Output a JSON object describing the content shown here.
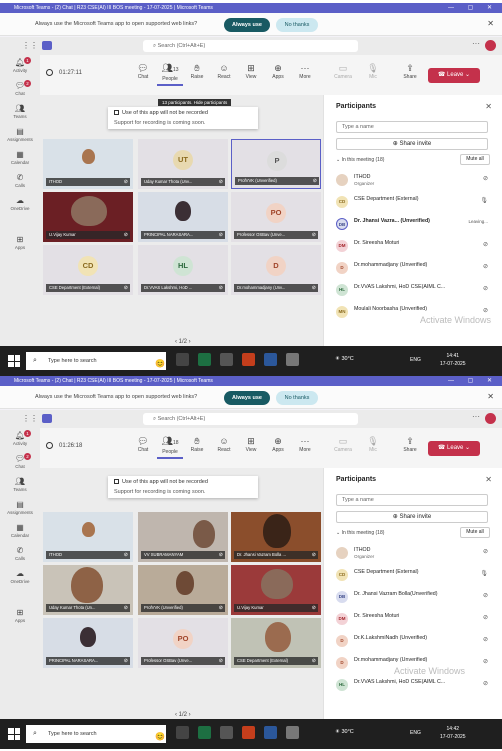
{
  "screens": [
    {
      "title": "Microsoft Teams - (2) Chat | R23 CSE(AI) III BOS meeting - 17-07-2025 | Microsoft Teams",
      "infobar": {
        "message": "Always use the Microsoft Teams app to open supported web links?",
        "always_use": "Always use",
        "no_thanks": "No thanks"
      },
      "search_placeholder": "Search (Ctrl+Alt+E)",
      "rail": [
        "Activity",
        "Chat",
        "Teams",
        "Assignments",
        "Calendar",
        "Calls",
        "OneDrive",
        "Apps"
      ],
      "rail_badges": {
        "Activity": "1",
        "Chat": "2"
      },
      "timer": "01:27:11",
      "people_count": "13",
      "toolbar": [
        "Chat",
        "People",
        "Raise",
        "React",
        "View",
        "Apps",
        "More",
        "Camera",
        "Mic",
        "Share"
      ],
      "leave": "Leave",
      "tooltip": "13 participants. Hide participants",
      "banner": {
        "line1": "Use of this app will not be recorded",
        "line2": "Support for recording is coming soon."
      },
      "tiles": [
        {
          "initials": "",
          "name": "ITHOD"
        },
        {
          "initials": "UT",
          "name": "Uday Kumar Thota (Unv..."
        },
        {
          "initials": "P",
          "name": "ProfVVK (Unverified)"
        },
        {
          "initials": "",
          "name": "U.Vijay Kumar"
        },
        {
          "initials": "",
          "name": "PRINCIPAL NARASARA..."
        },
        {
          "initials": "PO",
          "name": "Professor OSBav (Unve..."
        },
        {
          "initials": "CD",
          "name": "CSE Department (External)"
        },
        {
          "initials": "HL",
          "name": "Dr.VVAS Lakshmi, HoD ..."
        },
        {
          "initials": "D",
          "name": "Dr.mohammadjany (Unv..."
        }
      ],
      "pager": "1/2",
      "panel": {
        "title": "Participants",
        "search_placeholder": "Type a name",
        "share_invite": "Share invite",
        "section": "In this meeting (18)",
        "mute_all": "Mute all",
        "people": [
          {
            "initials": "",
            "name": "ITHOD",
            "role": "Organizer"
          },
          {
            "initials": "CD",
            "name": "CSE Department (External)",
            "role": ""
          },
          {
            "initials": "DB",
            "name": "Dr. Jhansi Vazra... (Unverified)",
            "role": "",
            "extra": "Leaving..."
          },
          {
            "initials": "DM",
            "name": "Dr. Sireesha Moturi",
            "role": ""
          },
          {
            "initials": "D",
            "name": "Dr.mohammadjany (Unverified)",
            "role": ""
          },
          {
            "initials": "HL",
            "name": "Dr.VVAS Lakshmi, HoD CSE(AIML C...",
            "role": ""
          },
          {
            "initials": "MN",
            "name": "Moulali Noorbasha (Unverified)",
            "role": ""
          }
        ]
      },
      "watermark": "Activate Windows",
      "taskbar": {
        "search": "Type here to search",
        "weather": "30°C",
        "lang": "ENG",
        "time": "14:41",
        "date": "17-07-2025"
      }
    },
    {
      "title": "Microsoft Teams - (2) Chat | R23 CSE(AI) III BOS meeting - 17-07-2025 | Microsoft Teams",
      "infobar": {
        "message": "Always use the Microsoft Teams app to open supported web links?",
        "always_use": "Always use",
        "no_thanks": "No thanks"
      },
      "search_placeholder": "Search (Ctrl+Alt+E)",
      "rail": [
        "Activity",
        "Chat",
        "Teams",
        "Assignments",
        "Calendar",
        "Calls",
        "OneDrive",
        "Apps"
      ],
      "rail_badges": {
        "Activity": "1",
        "Chat": "2"
      },
      "timer": "01:26:18",
      "people_count": "18",
      "toolbar": [
        "Chat",
        "People",
        "Raise",
        "React",
        "View",
        "Apps",
        "More",
        "Camera",
        "Mic",
        "Share"
      ],
      "leave": "Leave",
      "banner": {
        "line1": "Use of this app will not be recorded",
        "line2": "Support for recording is coming soon."
      },
      "tiles": [
        {
          "initials": "",
          "name": "ITHOD"
        },
        {
          "initials": "",
          "name": "VV SUBRAMANYAM"
        },
        {
          "initials": "",
          "name": "Dr. Jhansi Vazram Bolla ..."
        },
        {
          "initials": "",
          "name": "Uday Kumar Thota (Un..."
        },
        {
          "initials": "",
          "name": "ProfVVK (Unverified)"
        },
        {
          "initials": "",
          "name": "U.Vijay Kumar"
        },
        {
          "initials": "",
          "name": "PRINCIPAL NARASARA..."
        },
        {
          "initials": "PO",
          "name": "Professor OSBav (Unve..."
        },
        {
          "initials": "",
          "name": "CSE Department (External)"
        }
      ],
      "pager": "1/2",
      "panel": {
        "title": "Participants",
        "search_placeholder": "Type a name",
        "share_invite": "Share invite",
        "section": "In this meeting (18)",
        "mute_all": "Mute all",
        "people": [
          {
            "initials": "",
            "name": "ITHOD",
            "role": "Organizer"
          },
          {
            "initials": "CD",
            "name": "CSE Department (External)",
            "role": ""
          },
          {
            "initials": "DB",
            "name": "Dr. Jhansi Vazram Bolla(Unverified)",
            "role": ""
          },
          {
            "initials": "DM",
            "name": "Dr. Sireesha Moturi",
            "role": ""
          },
          {
            "initials": "D",
            "name": "Dr.K.LakshmiNadh (Unverified)",
            "role": ""
          },
          {
            "initials": "D",
            "name": "Dr.mohammadjany (Unverified)",
            "role": ""
          },
          {
            "initials": "HL",
            "name": "Dr.VVAS Lakshmi, HoD CSE(AIML C...",
            "role": ""
          }
        ]
      },
      "watermark": "Activate Windows",
      "taskbar": {
        "search": "Type here to search",
        "weather": "30°C",
        "lang": "ENG",
        "time": "14:42",
        "date": "17-07-2025"
      }
    }
  ],
  "colors": {
    "teams_purple": "#5b5fc7",
    "leave_red": "#c4314b",
    "taskbar": "#1f1f1f",
    "infobar_button": "#185a63"
  }
}
